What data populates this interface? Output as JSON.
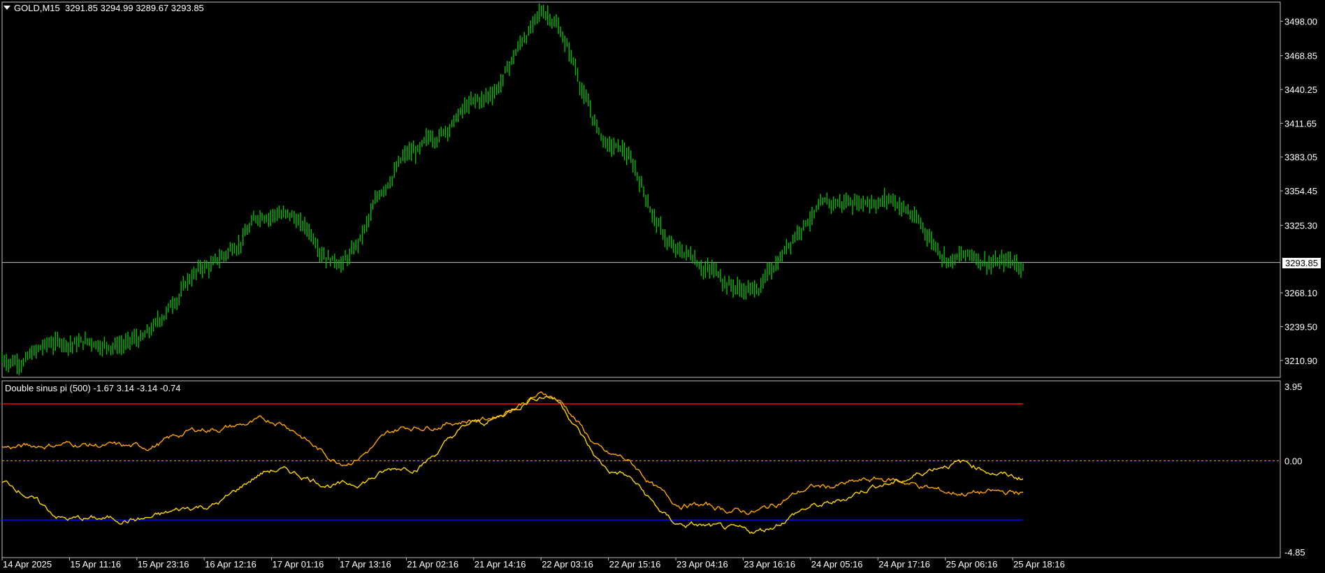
{
  "window": {
    "symbol_tf": "GOLD,M15",
    "ohlc": "3291.85 3294.99 3289.67 3293.85",
    "current_price": "3293.85"
  },
  "indicator": {
    "title": "Double sinus pi (500)",
    "values": "-1.67 3.14 -3.14 -0.74",
    "axis_labels": [
      "3.95",
      "0.00",
      "-4.85"
    ],
    "upper_level": 3.14,
    "lower_level": -3.14,
    "zero_level": 0.0
  },
  "price_axis": [
    "3498.00",
    "3468.85",
    "3440.25",
    "3411.65",
    "3383.05",
    "3354.45",
    "3325.30",
    "3293.85",
    "3268.10",
    "3239.50",
    "3210.90"
  ],
  "time_axis": [
    "14 Apr 2025",
    "15 Apr 11:16",
    "15 Apr 23:16",
    "16 Apr 12:16",
    "17 Apr 01:16",
    "17 Apr 13:16",
    "21 Apr 02:16",
    "21 Apr 14:16",
    "22 Apr 03:16",
    "22 Apr 15:16",
    "23 Apr 04:16",
    "23 Apr 16:16",
    "24 Apr 05:16",
    "24 Apr 17:16",
    "25 Apr 06:16",
    "25 Apr 18:16"
  ],
  "colors": {
    "background": "#000000",
    "price_bars": "#00c000",
    "line_a": "#ffa500",
    "line_b": "#ffd700",
    "upper_level": "#ff0000",
    "lower_level": "#0000ff",
    "zero_level": "#ffa500",
    "grid_frame": "#c0c0c0"
  },
  "chart_data": [
    {
      "type": "line",
      "title": "GOLD,M15",
      "xlabel": "",
      "ylabel": "",
      "ylim": [
        3196.6,
        3514.2
      ],
      "categories": [
        "14 Apr 2025",
        "15 Apr 11:16",
        "15 Apr 23:16",
        "16 Apr 12:16",
        "17 Apr 01:16",
        "17 Apr 13:16",
        "21 Apr 02:16",
        "21 Apr 14:16",
        "22 Apr 03:16",
        "22 Apr 15:16",
        "23 Apr 04:16",
        "23 Apr 16:16",
        "24 Apr 05:16",
        "24 Apr 17:16",
        "25 Apr 06:16",
        "25 Apr 18:16"
      ],
      "series": [
        {
          "values": [
            3212,
            3227,
            3228,
            3290,
            3340,
            3300,
            3385,
            3428,
            3503,
            3390,
            3300,
            3272,
            3340,
            3350,
            3300,
            3294
          ]
        }
      ]
    },
    {
      "type": "line",
      "title": "Double sinus pi (500)",
      "xlabel": "",
      "ylabel": "",
      "ylim": [
        -4.85,
        3.95
      ],
      "categories": [
        "14 Apr 2025",
        "15 Apr 11:16",
        "15 Apr 23:16",
        "16 Apr 12:16",
        "17 Apr 01:16",
        "17 Apr 13:16",
        "21 Apr 02:16",
        "21 Apr 14:16",
        "22 Apr 03:16",
        "22 Apr 15:16",
        "23 Apr 04:16",
        "23 Apr 16:16",
        "24 Apr 05:16",
        "24 Apr 17:16",
        "25 Apr 06:16",
        "25 Apr 18:16"
      ],
      "series": [
        {
          "values": [
            0.7,
            0.9,
            0.7,
            1.7,
            2.1,
            0.0,
            1.8,
            2.2,
            3.5,
            0.2,
            -2.3,
            -2.7,
            -1.4,
            -1.0,
            -1.7,
            -1.7
          ]
        },
        {
          "values": [
            -1.2,
            -3.1,
            -3.1,
            -2.4,
            -0.5,
            -1.3,
            -0.3,
            2.0,
            3.5,
            -0.6,
            -3.4,
            -3.8,
            -2.4,
            -1.2,
            -0.1,
            -0.9
          ]
        }
      ]
    }
  ]
}
